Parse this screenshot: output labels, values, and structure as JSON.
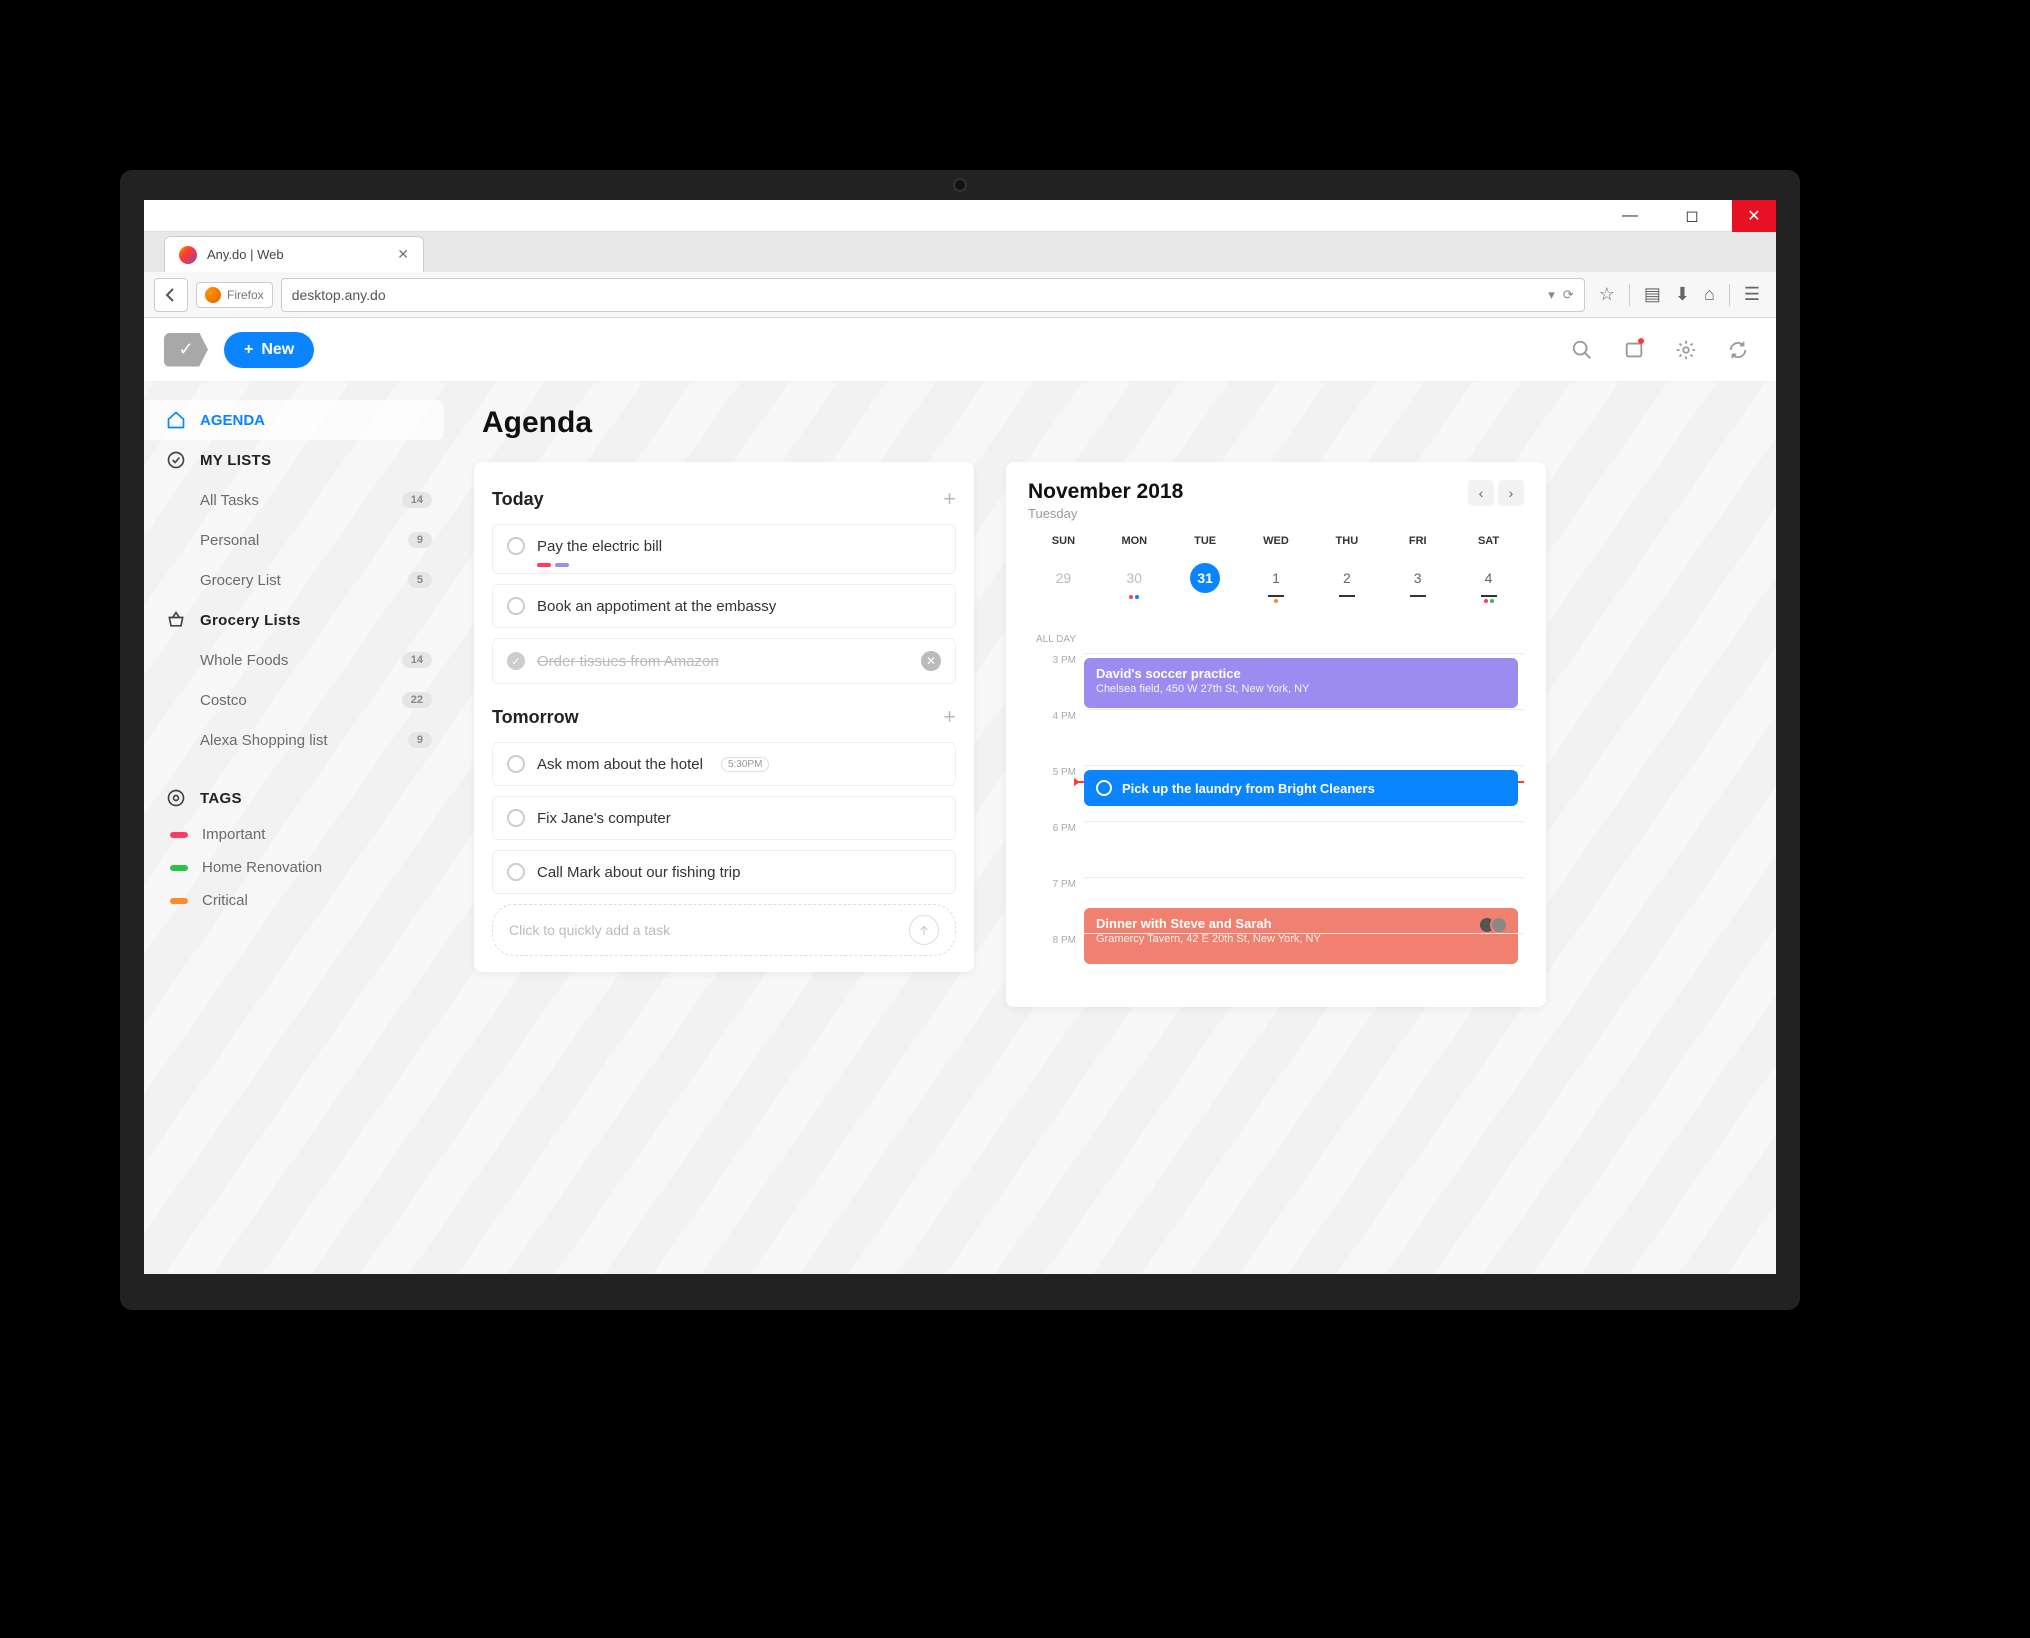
{
  "browser": {
    "tab_title": "Any.do | Web",
    "firefox_label": "Firefox",
    "url": "desktop.any.do"
  },
  "header": {
    "new_button": "New"
  },
  "sidebar": {
    "agenda": "AGENDA",
    "mylists": "MY LISTS",
    "lists": [
      {
        "label": "All Tasks",
        "count": "14"
      },
      {
        "label": "Personal",
        "count": "9"
      },
      {
        "label": "Grocery List",
        "count": "5"
      }
    ],
    "grocery_header": "Grocery Lists",
    "grocery": [
      {
        "label": "Whole Foods",
        "count": "14"
      },
      {
        "label": "Costco",
        "count": "22"
      },
      {
        "label": "Alexa Shopping list",
        "count": "9"
      }
    ],
    "tags_header": "TAGS",
    "tags": [
      {
        "label": "Important",
        "color": "#ff3b66"
      },
      {
        "label": "Home Renovation",
        "color": "#2fbf4b"
      },
      {
        "label": "Critical",
        "color": "#ff8a2b"
      }
    ]
  },
  "agenda": {
    "title": "Agenda",
    "today_label": "Today",
    "tomorrow_label": "Tomorrow",
    "today": [
      {
        "text": "Pay the electric bill",
        "tags": [
          "#ff3b66",
          "#9d8cf0"
        ]
      },
      {
        "text": "Book an appotiment at the embassy"
      },
      {
        "text": "Order tissues from Amazon",
        "done": true
      }
    ],
    "tomorrow": [
      {
        "text": "Ask mom about the hotel",
        "time": "5:30PM"
      },
      {
        "text": "Fix Jane's computer"
      },
      {
        "text": "Call Mark about our fishing trip"
      }
    ],
    "quick_add_placeholder": "Click to quickly add a task"
  },
  "calendar": {
    "month": "November 2018",
    "dayname": "Tuesday",
    "dow": [
      "SUN",
      "MON",
      "TUE",
      "WED",
      "THU",
      "FRI",
      "SAT"
    ],
    "dates": [
      {
        "n": "29",
        "muted": true
      },
      {
        "n": "30",
        "muted": true,
        "dots": [
          "#ff3b66",
          "#0a84ff"
        ]
      },
      {
        "n": "31",
        "today": true
      },
      {
        "n": "1",
        "underline": true,
        "dots": [
          "#ff8a2b"
        ]
      },
      {
        "n": "2",
        "underline": true
      },
      {
        "n": "3",
        "underline": true
      },
      {
        "n": "4",
        "underline": true,
        "dots": [
          "#ff3b66",
          "#2fbf4b"
        ]
      }
    ],
    "allday_label": "ALL DAY",
    "hours": [
      "3 PM",
      "4 PM",
      "5 PM",
      "6 PM",
      "7 PM",
      "8 PM"
    ],
    "events": {
      "soccer": {
        "title": "David's soccer practice",
        "sub": "Chelsea field, 450 W 27th St, New York, NY"
      },
      "laundry": {
        "title": "Pick up the laundry from Bright Cleaners"
      },
      "dinner": {
        "title": "Dinner with Steve and Sarah",
        "sub": "Gramercy Tavern, 42 E 20th St, New York, NY"
      }
    }
  }
}
